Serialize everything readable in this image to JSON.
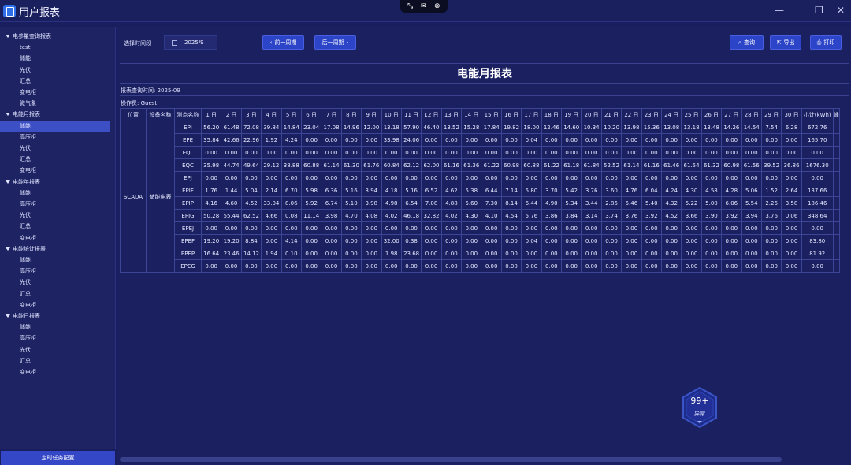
{
  "window": {
    "title": "用户报表",
    "minimize": "—",
    "maximize": "❐",
    "close": "✕"
  },
  "capture_bar": [
    "⤡",
    "✉",
    "⊗"
  ],
  "sidebar": {
    "items": [
      {
        "label": "电参量查询报表",
        "type": "group"
      },
      {
        "label": "test",
        "type": "child"
      },
      {
        "label": "储能",
        "type": "child"
      },
      {
        "label": "光伏",
        "type": "child"
      },
      {
        "label": "汇总",
        "type": "child"
      },
      {
        "label": "变电柜",
        "type": "child"
      },
      {
        "label": "微气象",
        "type": "child"
      },
      {
        "label": "电能月报表",
        "type": "group"
      },
      {
        "label": "储能",
        "type": "child",
        "active": true
      },
      {
        "label": "高压柜",
        "type": "child"
      },
      {
        "label": "光伏",
        "type": "child"
      },
      {
        "label": "汇总",
        "type": "child"
      },
      {
        "label": "变电柜",
        "type": "child"
      },
      {
        "label": "电能年报表",
        "type": "group"
      },
      {
        "label": "储能",
        "type": "child"
      },
      {
        "label": "高压柜",
        "type": "child"
      },
      {
        "label": "光伏",
        "type": "child"
      },
      {
        "label": "汇总",
        "type": "child"
      },
      {
        "label": "变电柜",
        "type": "child"
      },
      {
        "label": "电能统计报表",
        "type": "group"
      },
      {
        "label": "储能",
        "type": "child"
      },
      {
        "label": "高压柜",
        "type": "child"
      },
      {
        "label": "光伏",
        "type": "child"
      },
      {
        "label": "汇总",
        "type": "child"
      },
      {
        "label": "变电柜",
        "type": "child"
      },
      {
        "label": "电能日报表",
        "type": "group"
      },
      {
        "label": "储能",
        "type": "child"
      },
      {
        "label": "高压柜",
        "type": "child"
      },
      {
        "label": "光伏",
        "type": "child"
      },
      {
        "label": "汇总",
        "type": "child"
      },
      {
        "label": "变电柜",
        "type": "child"
      }
    ],
    "footer_button": "定时任务配置"
  },
  "toolbar": {
    "period_label": "选择时间段",
    "period_value": "2025/9",
    "prev_label": "前一周期",
    "next_label": "后一周期",
    "query_label": "查询",
    "export_label": "导出",
    "print_label": "打印"
  },
  "report": {
    "title": "电能月报表",
    "query_time": "报表查询时间: 2025-09",
    "operator": "操作员: Guest",
    "location": "SCADA",
    "device": "储能电表",
    "headers": [
      "位置",
      "设备名称",
      "测点名称",
      "1 日",
      "2 日",
      "3 日",
      "4 日",
      "5 日",
      "6 日",
      "7 日",
      "8 日",
      "9 日",
      "10 日",
      "11 日",
      "12 日",
      "13 日",
      "14 日",
      "15 日",
      "16 日",
      "17 日",
      "18 日",
      "19 日",
      "20 日",
      "21 日",
      "22 日",
      "23 日",
      "24 日",
      "25 日",
      "26 日",
      "27 日",
      "28 日",
      "29 日",
      "30 日",
      "小计(kWh)",
      "峰"
    ],
    "rows": [
      {
        "point": "EPI",
        "values": [
          "56.20",
          "61.48",
          "72.08",
          "39.84",
          "14.84",
          "23.04",
          "17.08",
          "14.96",
          "12.00",
          "13.18",
          "57.90",
          "46.40",
          "13.52",
          "15.28",
          "17.84",
          "19.82",
          "18.00",
          "12.46",
          "14.60",
          "10.34",
          "10.20",
          "13.98",
          "15.36",
          "13.08",
          "13.18",
          "13.48",
          "14.26",
          "14.54",
          "7.54",
          "6.28",
          "672.76"
        ]
      },
      {
        "point": "EPE",
        "values": [
          "35.84",
          "42.66",
          "22.96",
          "1.92",
          "4.24",
          "0.00",
          "0.00",
          "0.00",
          "0.00",
          "33.98",
          "24.06",
          "0.00",
          "0.00",
          "0.00",
          "0.00",
          "0.00",
          "0.04",
          "0.00",
          "0.00",
          "0.00",
          "0.00",
          "0.00",
          "0.00",
          "0.00",
          "0.00",
          "0.00",
          "0.00",
          "0.00",
          "0.00",
          "0.00",
          "165.70"
        ]
      },
      {
        "point": "EQL",
        "values": [
          "0.00",
          "0.00",
          "0.00",
          "0.00",
          "0.00",
          "0.00",
          "0.00",
          "0.00",
          "0.00",
          "0.00",
          "0.00",
          "0.00",
          "0.00",
          "0.00",
          "0.00",
          "0.00",
          "0.00",
          "0.00",
          "0.00",
          "0.00",
          "0.00",
          "0.00",
          "0.00",
          "0.00",
          "0.00",
          "0.00",
          "0.00",
          "0.00",
          "0.00",
          "0.00",
          "0.00"
        ]
      },
      {
        "point": "EQC",
        "values": [
          "35.98",
          "44.74",
          "49.64",
          "29.12",
          "38.88",
          "60.88",
          "61.14",
          "61.30",
          "61.76",
          "60.84",
          "62.12",
          "62.00",
          "61.16",
          "61.36",
          "61.22",
          "60.98",
          "60.88",
          "61.22",
          "61.18",
          "61.84",
          "52.52",
          "61.14",
          "61.16",
          "61.46",
          "61.54",
          "61.32",
          "60.98",
          "61.56",
          "39.52",
          "36.86",
          "1676.30"
        ]
      },
      {
        "point": "EPJ",
        "values": [
          "0.00",
          "0.00",
          "0.00",
          "0.00",
          "0.00",
          "0.00",
          "0.00",
          "0.00",
          "0.00",
          "0.00",
          "0.00",
          "0.00",
          "0.00",
          "0.00",
          "0.00",
          "0.00",
          "0.00",
          "0.00",
          "0.00",
          "0.00",
          "0.00",
          "0.00",
          "0.00",
          "0.00",
          "0.00",
          "0.00",
          "0.00",
          "0.00",
          "0.00",
          "0.00",
          "0.00"
        ]
      },
      {
        "point": "EPIF",
        "values": [
          "1.76",
          "1.44",
          "5.04",
          "2.14",
          "6.70",
          "5.98",
          "6.36",
          "5.16",
          "3.94",
          "4.18",
          "5.16",
          "6.52",
          "4.62",
          "5.38",
          "6.44",
          "7.14",
          "5.80",
          "3.70",
          "5.42",
          "3.76",
          "3.60",
          "4.76",
          "6.04",
          "4.24",
          "4.30",
          "4.58",
          "4.28",
          "5.06",
          "1.52",
          "2.64",
          "137.66"
        ]
      },
      {
        "point": "EPIP",
        "values": [
          "4.16",
          "4.60",
          "4.52",
          "33.04",
          "8.06",
          "5.92",
          "6.74",
          "5.10",
          "3.98",
          "4.98",
          "6.54",
          "7.08",
          "4.88",
          "5.60",
          "7.30",
          "8.14",
          "6.44",
          "4.90",
          "5.34",
          "3.44",
          "2.86",
          "5.46",
          "5.40",
          "4.32",
          "5.22",
          "5.00",
          "6.06",
          "5.54",
          "2.26",
          "3.58",
          "186.46"
        ]
      },
      {
        "point": "EPIG",
        "values": [
          "50.28",
          "55.44",
          "62.52",
          "4.66",
          "0.08",
          "11.14",
          "3.98",
          "4.70",
          "4.08",
          "4.02",
          "46.18",
          "32.82",
          "4.02",
          "4.30",
          "4.10",
          "4.54",
          "5.76",
          "3.86",
          "3.84",
          "3.14",
          "3.74",
          "3.76",
          "3.92",
          "4.52",
          "3.66",
          "3.90",
          "3.92",
          "3.94",
          "3.76",
          "0.06",
          "348.64"
        ]
      },
      {
        "point": "EPEJ",
        "values": [
          "0.00",
          "0.00",
          "0.00",
          "0.00",
          "0.00",
          "0.00",
          "0.00",
          "0.00",
          "0.00",
          "0.00",
          "0.00",
          "0.00",
          "0.00",
          "0.00",
          "0.00",
          "0.00",
          "0.00",
          "0.00",
          "0.00",
          "0.00",
          "0.00",
          "0.00",
          "0.00",
          "0.00",
          "0.00",
          "0.00",
          "0.00",
          "0.00",
          "0.00",
          "0.00",
          "0.00"
        ]
      },
      {
        "point": "EPEF",
        "values": [
          "19.20",
          "19.20",
          "8.84",
          "0.00",
          "4.14",
          "0.00",
          "0.00",
          "0.00",
          "0.00",
          "32.00",
          "0.38",
          "0.00",
          "0.00",
          "0.00",
          "0.00",
          "0.00",
          "0.04",
          "0.00",
          "0.00",
          "0.00",
          "0.00",
          "0.00",
          "0.00",
          "0.00",
          "0.00",
          "0.00",
          "0.00",
          "0.00",
          "0.00",
          "0.00",
          "83.80"
        ]
      },
      {
        "point": "EPEP",
        "values": [
          "16.64",
          "23.46",
          "14.12",
          "1.94",
          "0.10",
          "0.00",
          "0.00",
          "0.00",
          "0.00",
          "1.98",
          "23.68",
          "0.00",
          "0.00",
          "0.00",
          "0.00",
          "0.00",
          "0.00",
          "0.00",
          "0.00",
          "0.00",
          "0.00",
          "0.00",
          "0.00",
          "0.00",
          "0.00",
          "0.00",
          "0.00",
          "0.00",
          "0.00",
          "0.00",
          "81.92"
        ]
      },
      {
        "point": "EPEG",
        "values": [
          "0.00",
          "0.00",
          "0.00",
          "0.00",
          "0.00",
          "0.00",
          "0.00",
          "0.00",
          "0.00",
          "0.00",
          "0.00",
          "0.00",
          "0.00",
          "0.00",
          "0.00",
          "0.00",
          "0.00",
          "0.00",
          "0.00",
          "0.00",
          "0.00",
          "0.00",
          "0.00",
          "0.00",
          "0.00",
          "0.00",
          "0.00",
          "0.00",
          "0.00",
          "0.00",
          "0.00"
        ]
      }
    ]
  },
  "alarm_badge": {
    "count": "99+",
    "label": "异常"
  },
  "colors": {
    "bg": "#191e5e",
    "accent": "#2c44c7",
    "active": "#3d4fc5",
    "border": "#3d4597"
  }
}
